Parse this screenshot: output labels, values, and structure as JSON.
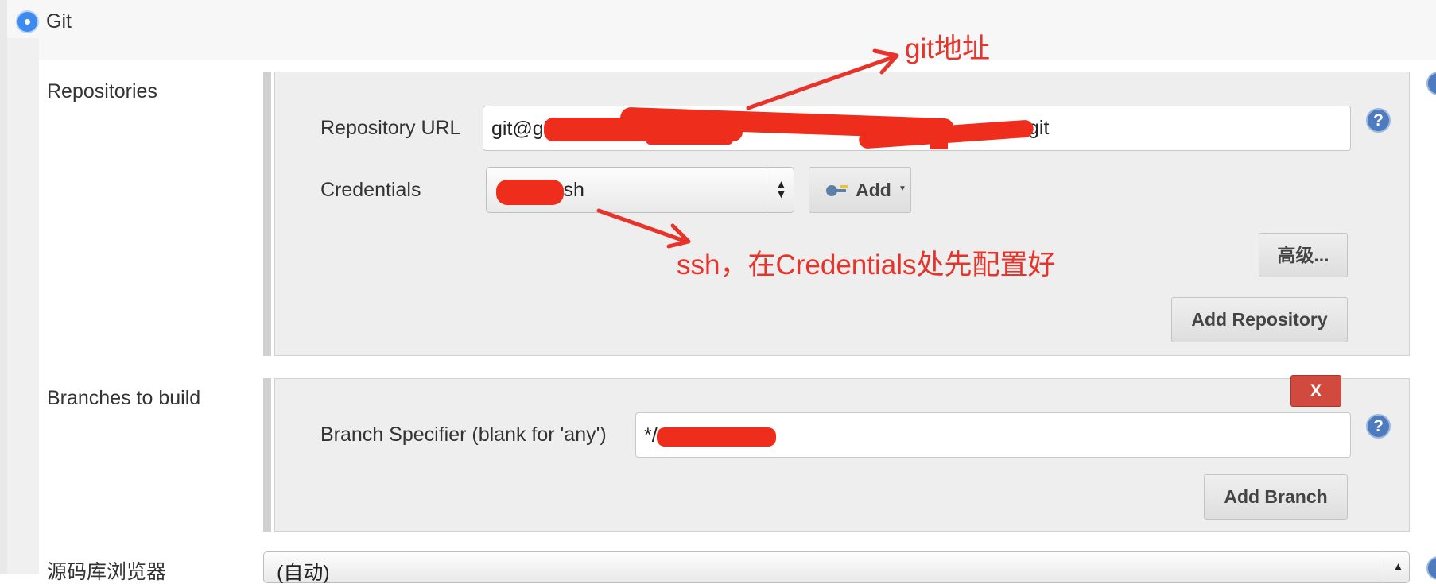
{
  "scm": {
    "git_label": "Git"
  },
  "repositories": {
    "label": "Repositories",
    "url_label": "Repository URL",
    "url_value": "git@git",
    "url_value_tail": "git",
    "credentials_label": "Credentials",
    "credentials_value": "ssh",
    "add_label": "Add",
    "advanced_label": "高级...",
    "add_repository_label": "Add Repository"
  },
  "branches": {
    "label": "Branches to build",
    "specifier_label": "Branch Specifier (blank for 'any')",
    "specifier_value": "*/",
    "delete_label": "X",
    "add_branch_label": "Add Branch"
  },
  "browser": {
    "label": "源码库浏览器",
    "value": "(自动)"
  },
  "help": {
    "icon_glyph": "?"
  },
  "annotations": {
    "git_address": "git地址",
    "ssh_note": "ssh，在Credentials处先配置好"
  },
  "colors": {
    "annotation": "#e8332a",
    "radio": "#3d8bf0",
    "help": "#4d7bbe",
    "delete": "#d24a3e"
  }
}
